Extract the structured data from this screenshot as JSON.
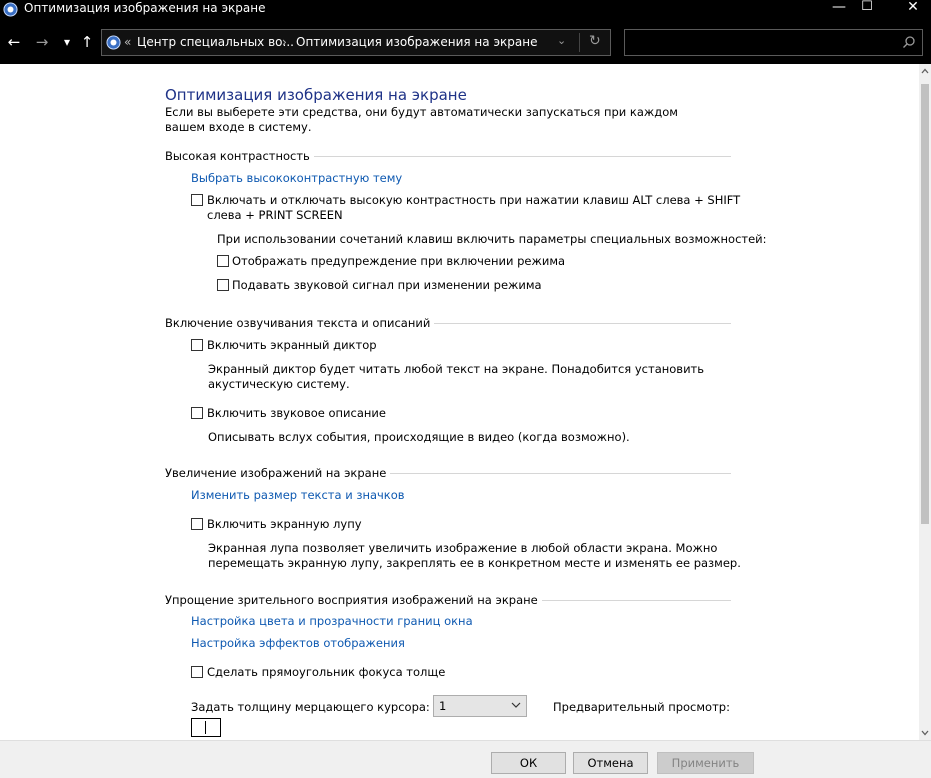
{
  "window": {
    "title": "Оптимизация изображения на экране",
    "minimize_glyph": "—",
    "maximize_glyph": "☐",
    "close_glyph": "✕"
  },
  "nav": {
    "back_glyph": "←",
    "forward_glyph": "→",
    "recent_glyph": "▾",
    "up_glyph": "↑",
    "breadcrumb_chevron": "«",
    "crumb1": "Центр специальных во...",
    "separator": "›",
    "crumb2": "Оптимизация изображения на экране",
    "dropdown_glyph": "⌄",
    "refresh_glyph": "↻",
    "search_placeholder": ""
  },
  "page": {
    "title": "Оптимизация изображения на экране",
    "intro": "Если вы выберете эти средства, они будут автоматически запускаться при каждом вашем входе в систему."
  },
  "high_contrast": {
    "heading": "Высокая контрастность",
    "link": "Выбрать высококонтрастную тему",
    "toggle_label": "Включать и отключать высокую контрастность при нажатии клавиш ALT слева + SHIFT слева + PRINT SCREEN",
    "shortcut_note": "При использовании сочетаний клавиш включить параметры специальных возможностей:",
    "warn_label": "Отображать предупреждение при включении режима",
    "sound_label": "Подавать звуковой сигнал при изменении режима"
  },
  "narration": {
    "heading": "Включение озвучивания текста и описаний",
    "narrator_label": "Включить экранный диктор",
    "narrator_desc": "Экранный диктор будет читать любой текст на экране. Понадобится установить акустическую систему.",
    "audio_desc_label": "Включить звуковое описание",
    "audio_desc_desc": "Описывать вслух события, происходящие в видео (когда возможно)."
  },
  "magnify": {
    "heading": "Увеличение изображений на экране",
    "link": "Изменить размер текста и значков",
    "magnifier_label": "Включить экранную лупу",
    "magnifier_desc": "Экранная лупа позволяет увеличить изображение в любой области экрана. Можно перемещать экранную лупу, закреплять ее в конкретном месте и изменять ее размер."
  },
  "simplify": {
    "heading": "Упрощение зрительного восприятия изображений на экране",
    "link_color": "Настройка цвета и прозрачности границ окна",
    "link_effects": "Настройка эффектов отображения",
    "focus_label": "Сделать прямоугольник фокуса толще",
    "cursor_label": "Задать толщину мерцающего курсора:",
    "cursor_value": "1",
    "preview_label": "Предварительный просмотр:"
  },
  "footer": {
    "ok": "ОК",
    "cancel": "Отмена",
    "apply": "Применить"
  },
  "colors": {
    "title_link": "#1e3287",
    "link": "#0e59b1",
    "chrome": "#000000"
  }
}
